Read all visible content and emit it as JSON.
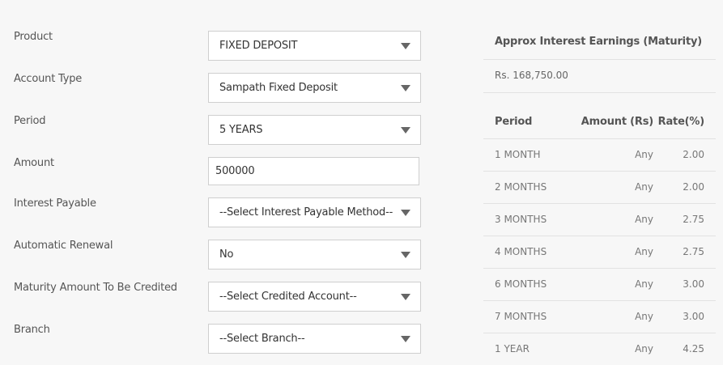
{
  "form": {
    "product": {
      "label": "Product",
      "value": "FIXED DEPOSIT"
    },
    "account_type": {
      "label": "Account Type",
      "value": "Sampath Fixed Deposit"
    },
    "period": {
      "label": "Period",
      "value": "5 YEARS"
    },
    "amount": {
      "label": "Amount",
      "value": "500000"
    },
    "interest_payable": {
      "label": "Interest Payable",
      "value": "--Select Interest Payable Method--"
    },
    "automatic_renewal": {
      "label": "Automatic Renewal",
      "value": "No"
    },
    "maturity_credit": {
      "label": "Maturity Amount To Be Credited",
      "value": "--Select Credited Account--"
    },
    "branch": {
      "label": "Branch",
      "value": "--Select Branch--"
    }
  },
  "earnings": {
    "title": "Approx Interest Earnings (Maturity)",
    "value": "Rs. 168,750.00"
  },
  "rates_table": {
    "headers": [
      "Period",
      "Amount (Rs)",
      "Rate(%)"
    ],
    "rows": [
      [
        "1 MONTH",
        "Any",
        "2.00"
      ],
      [
        "2 MONTHS",
        "Any",
        "2.00"
      ],
      [
        "3 MONTHS",
        "Any",
        "2.75"
      ],
      [
        "4 MONTHS",
        "Any",
        "2.75"
      ],
      [
        "6 MONTHS",
        "Any",
        "3.00"
      ],
      [
        "7 MONTHS",
        "Any",
        "3.00"
      ],
      [
        "1 YEAR",
        "Any",
        "4.25"
      ]
    ]
  }
}
